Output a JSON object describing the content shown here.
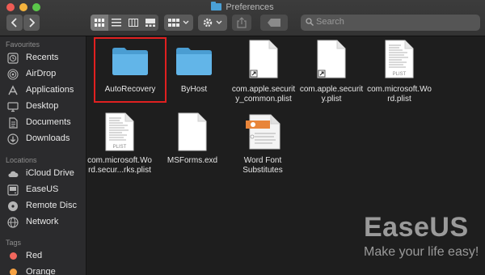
{
  "window": {
    "title": "Preferences"
  },
  "toolbar": {
    "search_placeholder": "Search"
  },
  "sidebar": {
    "favourites_header": "Favourites",
    "favourites": [
      {
        "label": "Recents"
      },
      {
        "label": "AirDrop"
      },
      {
        "label": "Applications"
      },
      {
        "label": "Desktop"
      },
      {
        "label": "Documents"
      },
      {
        "label": "Downloads"
      }
    ],
    "locations_header": "Locations",
    "locations": [
      {
        "label": "iCloud Drive"
      },
      {
        "label": "EaseUS"
      },
      {
        "label": "Remote Disc"
      },
      {
        "label": "Network"
      }
    ],
    "tags_header": "Tags",
    "tags": [
      {
        "label": "Red",
        "color": "#f2675d"
      },
      {
        "label": "Orange",
        "color": "#f5a142"
      }
    ]
  },
  "files": [
    {
      "name": "AutoRecovery",
      "kind": "folder"
    },
    {
      "name": "ByHost",
      "kind": "folder"
    },
    {
      "name": "com.apple.security_common.plist",
      "line1": "com.apple.securit",
      "line2": "y_common.plist",
      "kind": "alias-doc"
    },
    {
      "name": "com.apple.security.plist",
      "line1": "com.apple.securit",
      "line2": "y.plist",
      "kind": "alias-doc"
    },
    {
      "name": "com.microsoft.Word.plist",
      "line1": "com.microsoft.Wo",
      "line2": "rd.plist",
      "kind": "plist"
    },
    {
      "name": "com.microsoft.Word.securityrks.plist",
      "line1": "com.microsoft.Wo",
      "line2": "rd.secur...rks.plist",
      "kind": "plist"
    },
    {
      "name": "MSForms.exd",
      "kind": "doc"
    },
    {
      "name": "Word Font Substitutes",
      "line1": "Word Font",
      "line2": "Substitutes",
      "kind": "word"
    }
  ],
  "plist_badge": "PLIST",
  "watermark": {
    "brand": "EaseUS",
    "tagline": "Make your life easy!"
  },
  "colors": {
    "folder": "#5fb4e8",
    "selection": "#e02020",
    "accent": "#4aa0d6"
  }
}
